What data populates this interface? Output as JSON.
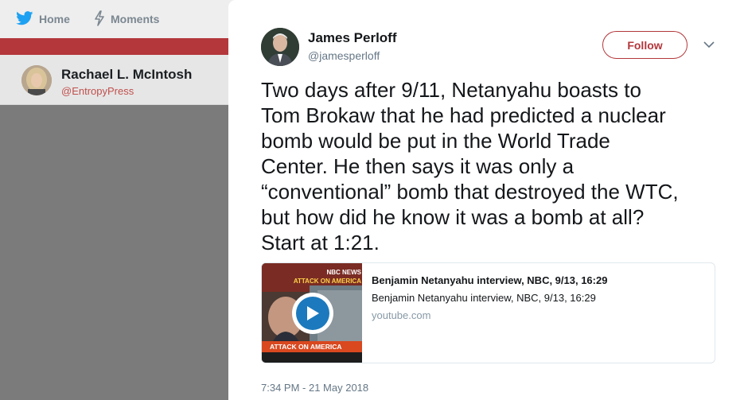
{
  "nav": {
    "home_label": "Home",
    "moments_label": "Moments"
  },
  "background_profile": {
    "name": "Rachael L. McIntosh",
    "handle": "@EntropyPress"
  },
  "tweet": {
    "author_name": "James Perloff",
    "author_handle": "@jamesperloff",
    "follow_label": "Follow",
    "text": "Two days after 9/11, Netanyahu boasts to\nTom Brokaw that he had predicted a nuclear\nbomb would be put in the World Trade\nCenter. He then says it was only a\n“conventional” bomb that destroyed the WTC,\nbut how did he know it was a bomb at all?\nStart at 1:21.",
    "timestamp": "7:34 PM - 21 May 2018"
  },
  "card": {
    "title": "Benjamin Netanyahu interview, NBC, 9/13, 16:29",
    "description": "Benjamin Netanyahu interview, NBC, 9/13, 16:29",
    "domain": "youtube.com",
    "thumbnail_top_text": "ATTACK ON AMERICA",
    "thumbnail_bottom_text": "ATTACK ON AMERICA",
    "thumbnail_network": "NBC NEWS"
  },
  "colors": {
    "brand_red": "#b3373b",
    "twitter_blue": "#1da1f2",
    "play_blue": "#1c79bd"
  },
  "icons": {
    "nav_home": "bird-icon",
    "nav_moments": "lightning-icon",
    "caret": "chevron-down-icon",
    "play": "play-icon"
  }
}
